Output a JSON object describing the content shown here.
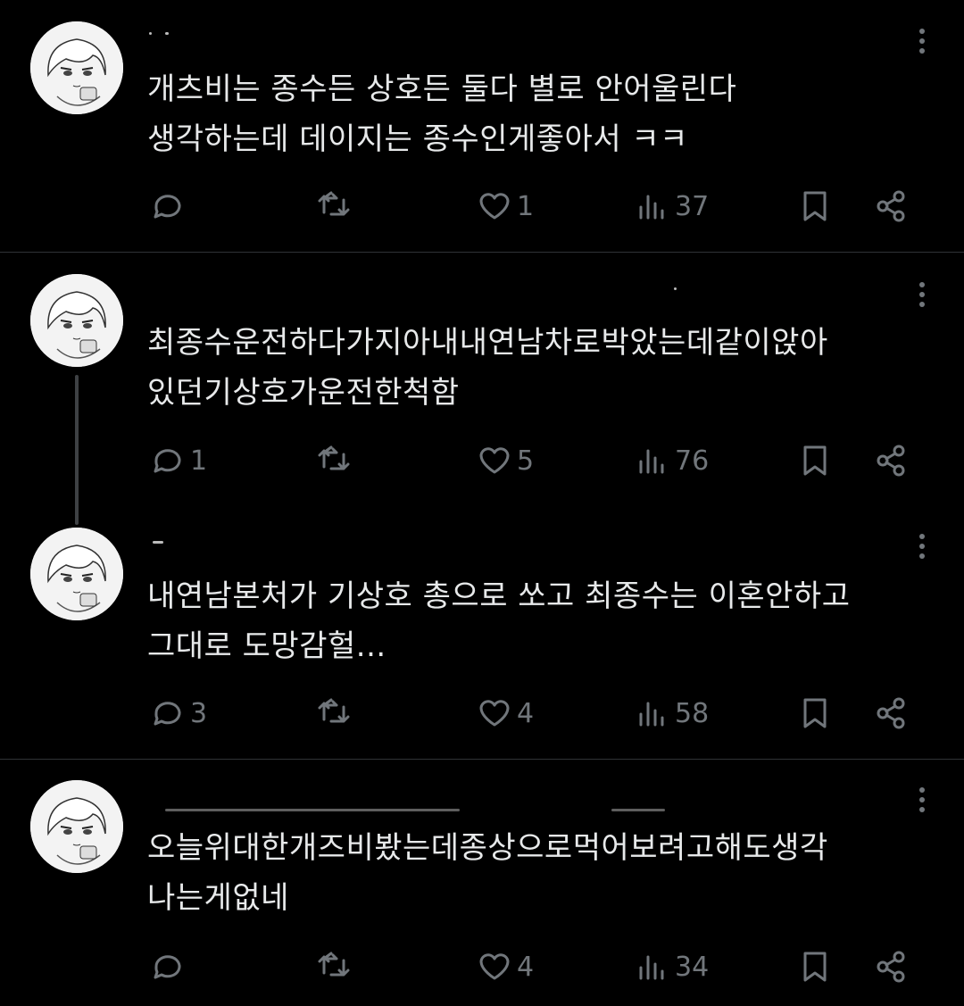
{
  "posts": [
    {
      "lines": [
        "개츠비는 종수든 상호든 둘다 별로 안어울린다",
        "생각하는데 데이지는 종수인게좋아서 ㅋㅋ"
      ],
      "reply_count": "",
      "repost_count": "",
      "like_count": "1",
      "view_count": "37"
    },
    {
      "lines": [
        "최종수운전하다가지아내내연남차로박았는데같이앉아",
        "있던기상호가운전한척함"
      ],
      "reply_count": "1",
      "repost_count": "",
      "like_count": "5",
      "view_count": "76"
    },
    {
      "lines": [
        "내연남본처가 기상호 총으로 쏘고 최종수는 이혼안하고",
        "그대로 도망감헐..."
      ],
      "reply_count": "3",
      "repost_count": "",
      "like_count": "4",
      "view_count": "58"
    },
    {
      "lines": [
        "오늘위대한개즈비봤는데종상으로먹어보려고해도생각",
        "나는게없네"
      ],
      "reply_count": "",
      "repost_count": "",
      "like_count": "4",
      "view_count": "34"
    }
  ],
  "icons": {
    "reply": "reply-icon",
    "repost": "repost-icon",
    "like": "heart-icon",
    "views": "views-icon",
    "bookmark": "bookmark-icon",
    "share": "share-icon",
    "more": "more-icon"
  },
  "colors": {
    "background": "#000000",
    "text": "#e7e9ea",
    "muted": "#71767b",
    "divider": "#2f3336"
  }
}
